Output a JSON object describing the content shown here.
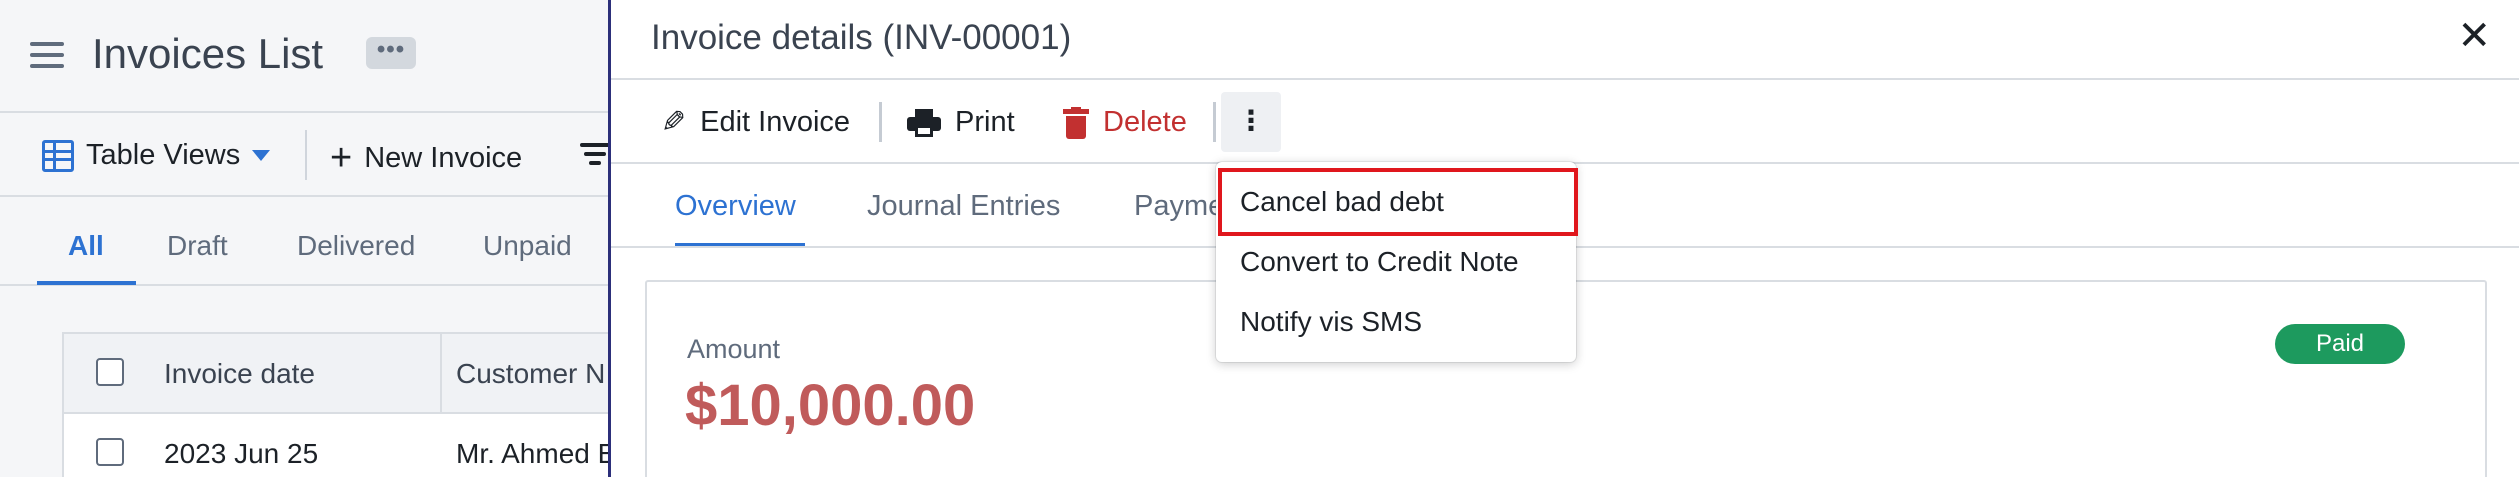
{
  "page": {
    "title": "Invoices List",
    "more_label": "•••"
  },
  "toolbar": {
    "table_views": "Table Views",
    "new_invoice": "New Invoice"
  },
  "list_tabs": [
    "All",
    "Draft",
    "Delivered",
    "Unpaid"
  ],
  "table": {
    "headers": [
      "Invoice date",
      "Customer N"
    ],
    "rows": [
      {
        "date": "2023 Jun 25",
        "customer": "Mr. Ahmed E"
      }
    ]
  },
  "drawer": {
    "title": "Invoice details (INV-00001)",
    "close": "✕",
    "actions": {
      "edit": "Edit Invoice",
      "print": "Print",
      "delete": "Delete",
      "more": "⋮"
    },
    "tabs": [
      "Overview",
      "Journal Entries",
      "Payme"
    ],
    "amount_label": "Amount",
    "amount_value": "$10,000.00",
    "status": "Paid"
  },
  "menu": {
    "items": [
      "Cancel bad debt",
      "Convert to Credit Note",
      "Notify vis SMS"
    ]
  },
  "colors": {
    "accent": "#2d72d2",
    "danger": "#c23030",
    "amount": "#c05b5b",
    "paid": "#1d9a5e",
    "highlight": "#e0171d"
  }
}
